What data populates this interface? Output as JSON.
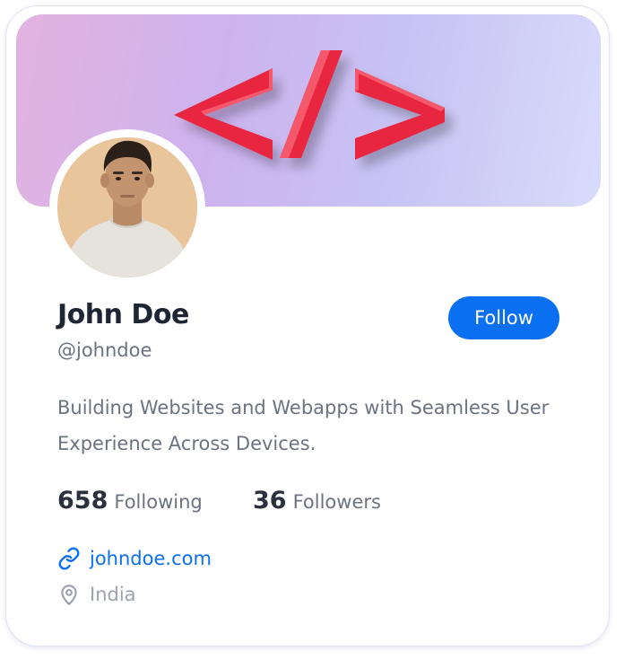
{
  "profile": {
    "name": "John Doe",
    "handle": "@johndoe",
    "bio": "Building Websites and Webapps with Seamless User Experience Across Devices.",
    "follow_label": "Follow",
    "following_count": "658",
    "following_label": "Following",
    "followers_count": "36",
    "followers_label": "Followers",
    "website": "johndoe.com",
    "location": "India"
  },
  "icons": {
    "banner_graphic": "code-tag-icon",
    "website": "link-icon",
    "location": "map-pin-icon"
  },
  "colors": {
    "accent": "#0a6ff1",
    "code_symbol": "#ef2f4a",
    "banner_gradient": [
      "#e2b3df",
      "#cdb3ee",
      "#c7c3f4",
      "#d9dbfb"
    ]
  }
}
